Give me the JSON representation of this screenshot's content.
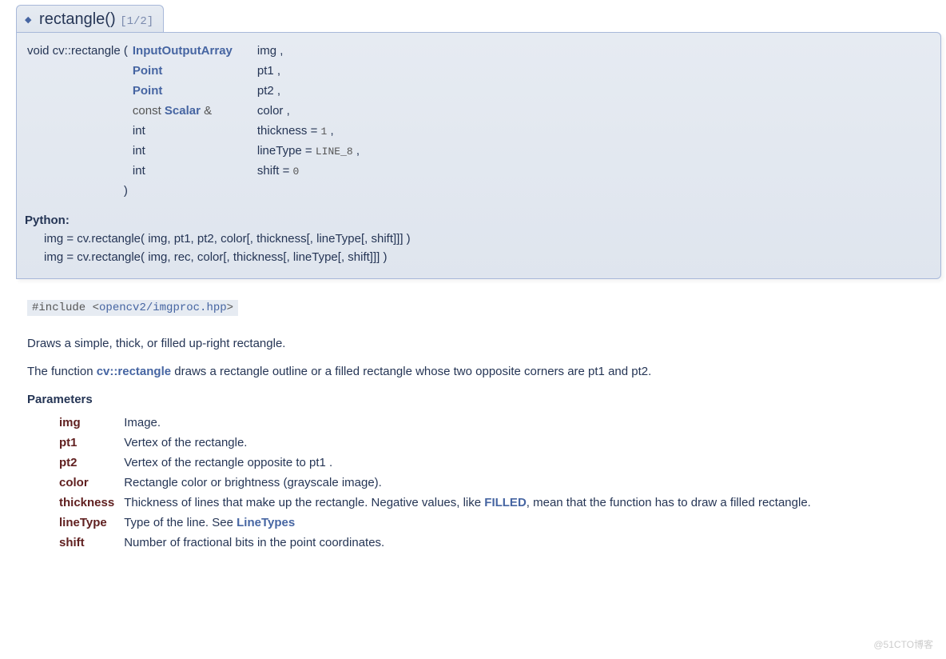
{
  "header": {
    "diamond": "◆",
    "fname": "rectangle()",
    "overload": "[1/2]"
  },
  "sig": {
    "ret": "void",
    "ns": "cv::rectangle",
    "open": "(",
    "close": ")",
    "rows": [
      {
        "type": "InputOutputArray",
        "type_link": true,
        "pre": "",
        "name": "img",
        "tail": ","
      },
      {
        "type": "Point",
        "type_link": true,
        "pre": "",
        "name": "pt1",
        "tail": ","
      },
      {
        "type": "Point",
        "type_link": true,
        "pre": "",
        "name": "pt2",
        "tail": ","
      },
      {
        "type": "Scalar",
        "type_link": true,
        "pre": "const ",
        "post": " &",
        "name": "color",
        "tail": ","
      },
      {
        "type": "int",
        "type_link": false,
        "pre": "",
        "name": "thickness",
        "assign": " = ",
        "value": "1",
        "tail": ","
      },
      {
        "type": "int",
        "type_link": false,
        "pre": "",
        "name": "lineType",
        "assign": " = ",
        "value": "LINE_8",
        "tail": ","
      },
      {
        "type": "int",
        "type_link": false,
        "pre": "",
        "name": "shift",
        "assign": " = ",
        "value": "0",
        "tail": ""
      }
    ]
  },
  "python": {
    "label": "Python:",
    "lines": [
      "img = cv.rectangle( img, pt1, pt2, color[, thickness[, lineType[, shift]]] )",
      "img = cv.rectangle( img, rec, color[, thickness[, lineType[, shift]]]        )"
    ]
  },
  "include": {
    "pre": "#include ",
    "lt": "<",
    "path": "opencv2/imgproc.hpp",
    "gt": ">"
  },
  "desc": {
    "p1": "Draws a simple, thick, or filled up-right rectangle.",
    "p2a": "The function ",
    "p2link": "cv::rectangle",
    "p2b": " draws a rectangle outline or a filled rectangle whose two opposite corners are pt1 and pt2."
  },
  "params_title": "Parameters",
  "params": [
    {
      "name": "img",
      "desc": "Image."
    },
    {
      "name": "pt1",
      "desc": "Vertex of the rectangle."
    },
    {
      "name": "pt2",
      "desc": "Vertex of the rectangle opposite to pt1 ."
    },
    {
      "name": "color",
      "desc": "Rectangle color or brightness (grayscale image)."
    },
    {
      "name": "thickness",
      "desc_a": "Thickness of lines that make up the rectangle. Negative values, like ",
      "link": "FILLED",
      "desc_b": ", mean that the function has to draw a filled rectangle."
    },
    {
      "name": "lineType",
      "desc_a": "Type of the line. See ",
      "link": "LineTypes",
      "desc_b": ""
    },
    {
      "name": "shift",
      "desc": "Number of fractional bits in the point coordinates."
    }
  ],
  "watermark": "@51CTO博客"
}
